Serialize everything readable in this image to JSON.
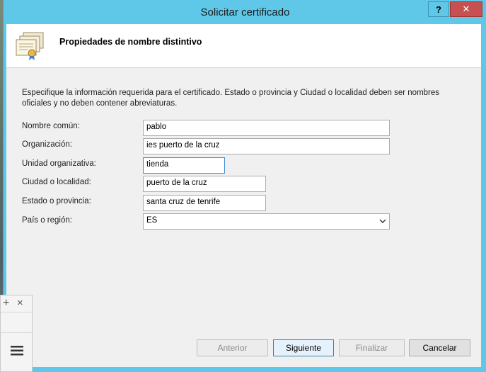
{
  "window": {
    "title": "Solicitar certificado",
    "help_glyph": "?",
    "close_glyph": "✕"
  },
  "header": {
    "title": "Propiedades de nombre distintivo",
    "icon": "certificate-icon"
  },
  "description": "Especifique la información requerida para el certificado. Estado o provincia y Ciudad o localidad deben ser nombres oficiales y no deben contener abreviaturas.",
  "form": {
    "common_name": {
      "label": "Nombre común:",
      "value": "pablo"
    },
    "organization": {
      "label": "Organización:",
      "value": "ies puerto de la cruz"
    },
    "org_unit": {
      "label": "Unidad organizativa:",
      "value": "tienda"
    },
    "city": {
      "label": "Ciudad o localidad:",
      "value": "puerto de la cruz"
    },
    "state": {
      "label": "Estado o provincia:",
      "value": "santa cruz de tenrife"
    },
    "country": {
      "label": "País o región:",
      "value": "ES"
    }
  },
  "buttons": {
    "back": "Anterior",
    "next": "Siguiente",
    "finish": "Finalizar",
    "cancel": "Cancelar"
  },
  "side_panel": {
    "plus_glyph": "+",
    "close_glyph": "×",
    "menu_icon": "hamburger-menu-icon"
  },
  "colors": {
    "titlebar": "#5fc8e8",
    "close_button": "#c75050",
    "focus_border": "#3a8ad4"
  }
}
